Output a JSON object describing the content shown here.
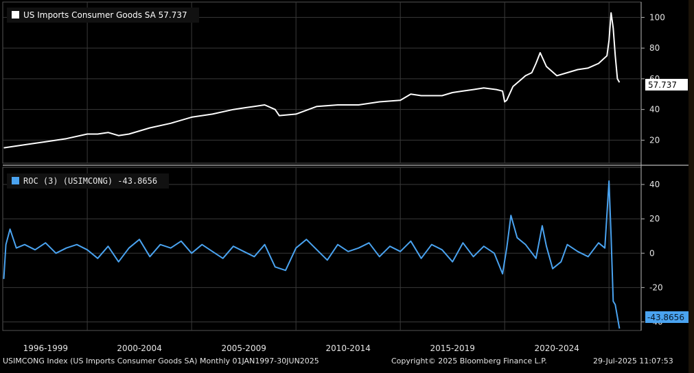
{
  "chart_data": [
    {
      "type": "line",
      "legend": "US Imports Consumer Goods SA 57.737",
      "last_value_label": "57.737",
      "line_color": "#ffffff",
      "ylim": [
        5,
        110
      ],
      "yticks": [
        "20",
        "40",
        "60",
        "80",
        "100"
      ],
      "x": [
        1996.0,
        1996.5,
        1997.0,
        1998.0,
        1999.0,
        2000.0,
        2000.5,
        2001.0,
        2001.5,
        2002.0,
        2003.0,
        2004.0,
        2005.0,
        2006.0,
        2007.0,
        2007.5,
        2008.0,
        2008.5,
        2009.0,
        2009.2,
        2010.0,
        2011.0,
        2012.0,
        2013.0,
        2014.0,
        2015.0,
        2015.5,
        2016.0,
        2017.0,
        2017.5,
        2018.0,
        2018.5,
        2019.0,
        2019.6,
        2019.9,
        2020.0,
        2020.1,
        2020.4,
        2021.0,
        2021.3,
        2021.5,
        2021.7,
        2022.0,
        2022.5,
        2023.0,
        2023.5,
        2024.0,
        2024.5,
        2024.9,
        2025.0,
        2025.1,
        2025.2,
        2025.3,
        2025.4,
        2025.5
      ],
      "y": [
        15,
        16,
        17,
        19,
        21,
        24,
        24,
        25,
        23,
        24,
        28,
        31,
        35,
        37,
        40,
        41,
        42,
        43,
        40,
        36,
        37,
        42,
        43,
        43,
        45,
        46,
        50,
        49,
        49,
        51,
        52,
        53,
        54,
        53,
        52,
        45,
        46,
        55,
        62,
        64,
        70,
        77,
        68,
        62,
        64,
        66,
        67,
        70,
        75,
        85,
        103,
        93,
        75,
        60,
        57.7
      ]
    },
    {
      "type": "line",
      "legend": "ROC (3) (USIMCONG) -43.8656",
      "last_value_label": "-43.8656",
      "line_color": "#4aa3f0",
      "ylim": [
        -45,
        50
      ],
      "yticks": [
        "-40",
        "-20",
        "0",
        "20",
        "40"
      ],
      "x": [
        1996.0,
        1996.1,
        1996.3,
        1996.6,
        1997.0,
        1997.5,
        1998.0,
        1998.5,
        1999.0,
        1999.5,
        2000.0,
        2000.5,
        2001.0,
        2001.5,
        2002.0,
        2002.5,
        2003.0,
        2003.5,
        2004.0,
        2004.5,
        2005.0,
        2005.5,
        2006.0,
        2006.5,
        2007.0,
        2007.5,
        2008.0,
        2008.5,
        2009.0,
        2009.5,
        2010.0,
        2010.5,
        2011.0,
        2011.5,
        2012.0,
        2012.5,
        2013.0,
        2013.5,
        2014.0,
        2014.5,
        2015.0,
        2015.5,
        2016.0,
        2016.5,
        2017.0,
        2017.5,
        2018.0,
        2018.5,
        2019.0,
        2019.5,
        2019.9,
        2020.1,
        2020.3,
        2020.6,
        2021.0,
        2021.5,
        2021.8,
        2022.0,
        2022.3,
        2022.7,
        2023.0,
        2023.5,
        2024.0,
        2024.5,
        2024.8,
        2025.0,
        2025.1,
        2025.2,
        2025.3,
        2025.5
      ],
      "y": [
        -15,
        5,
        14,
        3,
        5,
        2,
        6,
        0,
        3,
        5,
        2,
        -3,
        4,
        -5,
        3,
        8,
        -2,
        5,
        3,
        7,
        0,
        5,
        1,
        -3,
        4,
        1,
        -2,
        5,
        -8,
        -10,
        3,
        8,
        2,
        -4,
        5,
        1,
        3,
        6,
        -2,
        4,
        1,
        7,
        -3,
        5,
        2,
        -5,
        6,
        -2,
        4,
        0,
        -12,
        3,
        22,
        9,
        5,
        -3,
        16,
        4,
        -9,
        -5,
        5,
        1,
        -2,
        6,
        3,
        42,
        10,
        -28,
        -30,
        -43.9
      ]
    }
  ],
  "x_axis": {
    "ticks": [
      "1996-1999",
      "2000-2004",
      "2005-2009",
      "2010-2014",
      "2015-2019",
      "2020-2024"
    ]
  },
  "footer": {
    "left": "USIMCONG Index (US Imports Consumer Goods SA)  Monthly 01JAN1997-30JUN2025",
    "center": "Copyright© 2025 Bloomberg Finance L.P.",
    "right": "29-Jul-2025 11:07:53"
  }
}
